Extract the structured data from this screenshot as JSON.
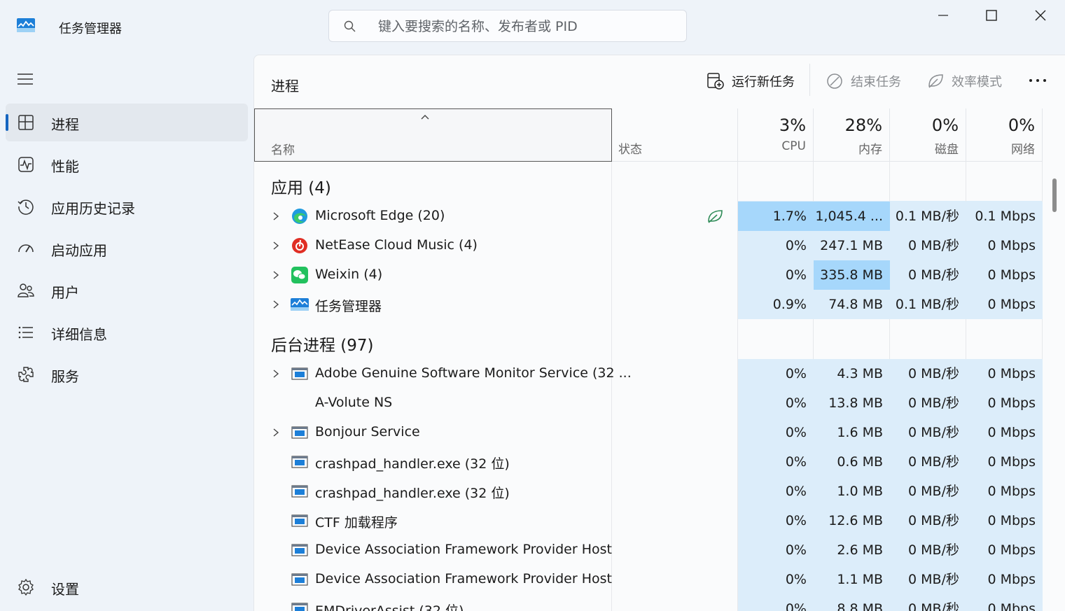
{
  "app": {
    "title": "任务管理器"
  },
  "search": {
    "placeholder": "键入要搜索的名称、发布者或 PID"
  },
  "sidebar": {
    "items": [
      {
        "label": "进程",
        "icon": "processes-icon",
        "active": true
      },
      {
        "label": "性能",
        "icon": "performance-icon"
      },
      {
        "label": "应用历史记录",
        "icon": "app-history-icon"
      },
      {
        "label": "启动应用",
        "icon": "startup-apps-icon"
      },
      {
        "label": "用户",
        "icon": "users-icon"
      },
      {
        "label": "详细信息",
        "icon": "details-icon"
      },
      {
        "label": "服务",
        "icon": "services-icon"
      }
    ],
    "settings": {
      "label": "设置",
      "icon": "settings-icon"
    }
  },
  "main": {
    "title": "进程",
    "toolbar": {
      "run_new_task": "运行新任务",
      "end_task": "结束任务",
      "efficiency_mode": "效率模式"
    },
    "columns": {
      "name": "名称",
      "status": "状态",
      "cpu": {
        "pct": "3%",
        "label": "CPU"
      },
      "memory": {
        "pct": "28%",
        "label": "内存"
      },
      "disk": {
        "pct": "0%",
        "label": "磁盘"
      },
      "network": {
        "pct": "0%",
        "label": "网络"
      }
    },
    "groups": [
      {
        "label": "应用 (4)",
        "rows": [
          {
            "name": "Microsoft Edge (20)",
            "icon": "edge-icon",
            "expandable": true,
            "status_icon": "efficiency-leaf-icon",
            "cpu": "1.7%",
            "mem": "1,045.4 ...",
            "disk": "0.1 MB/秒",
            "net": "0.1 Mbps",
            "hot": [
              "cpu",
              "mem"
            ]
          },
          {
            "name": "NetEase Cloud Music (4)",
            "icon": "netease-icon",
            "expandable": true,
            "cpu": "0%",
            "mem": "247.1 MB",
            "disk": "0 MB/秒",
            "net": "0 Mbps",
            "hot": []
          },
          {
            "name": "Weixin (4)",
            "icon": "weixin-icon",
            "expandable": true,
            "cpu": "0%",
            "mem": "335.8 MB",
            "disk": "0 MB/秒",
            "net": "0 Mbps",
            "hot": [
              "mem"
            ]
          },
          {
            "name": "任务管理器",
            "icon": "task-manager-icon",
            "expandable": true,
            "cpu": "0.9%",
            "mem": "74.8 MB",
            "disk": "0.1 MB/秒",
            "net": "0 Mbps",
            "hot": []
          }
        ]
      },
      {
        "label": "后台进程 (97)",
        "rows": [
          {
            "name": "Adobe Genuine Software Monitor Service (32 ...",
            "icon": "service-window-icon",
            "expandable": true,
            "cpu": "0%",
            "mem": "4.3 MB",
            "disk": "0 MB/秒",
            "net": "0 Mbps",
            "hot": []
          },
          {
            "name": "A-Volute NS",
            "icon": "blank-icon",
            "expandable": false,
            "cpu": "0%",
            "mem": "13.8 MB",
            "disk": "0 MB/秒",
            "net": "0 Mbps",
            "hot": []
          },
          {
            "name": "Bonjour Service",
            "icon": "service-window-icon",
            "expandable": true,
            "cpu": "0%",
            "mem": "1.6 MB",
            "disk": "0 MB/秒",
            "net": "0 Mbps",
            "hot": []
          },
          {
            "name": "crashpad_handler.exe (32 位)",
            "icon": "service-window-icon",
            "expandable": false,
            "cpu": "0%",
            "mem": "0.6 MB",
            "disk": "0 MB/秒",
            "net": "0 Mbps",
            "hot": []
          },
          {
            "name": "crashpad_handler.exe (32 位)",
            "icon": "service-window-icon",
            "expandable": false,
            "cpu": "0%",
            "mem": "1.0 MB",
            "disk": "0 MB/秒",
            "net": "0 Mbps",
            "hot": []
          },
          {
            "name": "CTF 加载程序",
            "icon": "service-window-icon",
            "expandable": false,
            "cpu": "0%",
            "mem": "12.6 MB",
            "disk": "0 MB/秒",
            "net": "0 Mbps",
            "hot": []
          },
          {
            "name": "Device Association Framework Provider Host",
            "icon": "service-window-icon",
            "expandable": false,
            "cpu": "0%",
            "mem": "2.6 MB",
            "disk": "0 MB/秒",
            "net": "0 Mbps",
            "hot": []
          },
          {
            "name": "Device Association Framework Provider Host",
            "icon": "service-window-icon",
            "expandable": false,
            "cpu": "0%",
            "mem": "1.1 MB",
            "disk": "0 MB/秒",
            "net": "0 Mbps",
            "hot": []
          },
          {
            "name": "EMDriverAssist (32 位)",
            "icon": "service-window-icon",
            "expandable": false,
            "cpu": "0%",
            "mem": "8.8 MB",
            "disk": "0 MB/秒",
            "net": "0 Mbps",
            "hot": []
          }
        ]
      }
    ]
  },
  "colors": {
    "heat_light": "#dcedfa",
    "heat_hot": "#a6d7fb",
    "accent": "#1565c0"
  }
}
